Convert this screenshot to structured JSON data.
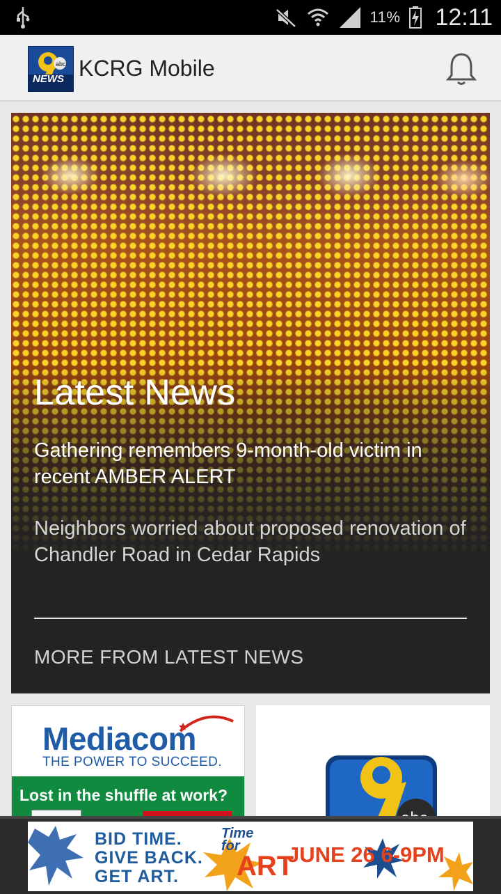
{
  "status_bar": {
    "icons": [
      "usb-icon",
      "mute-icon",
      "wifi-icon",
      "signal-icon",
      "battery-charging-icon"
    ],
    "battery_percent": "11%",
    "time": "12:11"
  },
  "app_bar": {
    "logo_icon": "kcrg-9-news-logo",
    "title": "KCRG Mobile",
    "notification_icon": "bell-icon"
  },
  "hero": {
    "title": "Latest News",
    "stories": [
      "Gathering remembers 9-month-old victim in recent AMBER ALERT",
      "Neighbors worried about proposed renovation of Chandler Road in Cedar Rapids"
    ],
    "more_link": "MORE FROM LATEST NEWS"
  },
  "cards": {
    "ad": {
      "brand": "Mediacom",
      "tagline": "THE POWER TO SUCCEED.",
      "subtext": "Lost in the shuffle at work?"
    },
    "logo_card": {
      "icon": "kcrg-9-abc-logo"
    }
  },
  "banner": {
    "left_lines": [
      "BID TIME.",
      "GIVE BACK.",
      "GET ART."
    ],
    "time_lines": [
      "Time",
      "for"
    ],
    "art_word": "ART",
    "date": "JUNE 26 6-9PM"
  },
  "colors": {
    "status_bar_bg": "#000000",
    "app_bar_bg": "#f0f0f0",
    "hero_bg": "#232323",
    "mediacom_blue": "#1f5ba6",
    "ad_green": "#0f8a3e",
    "banner_orange": "#e6411d"
  }
}
